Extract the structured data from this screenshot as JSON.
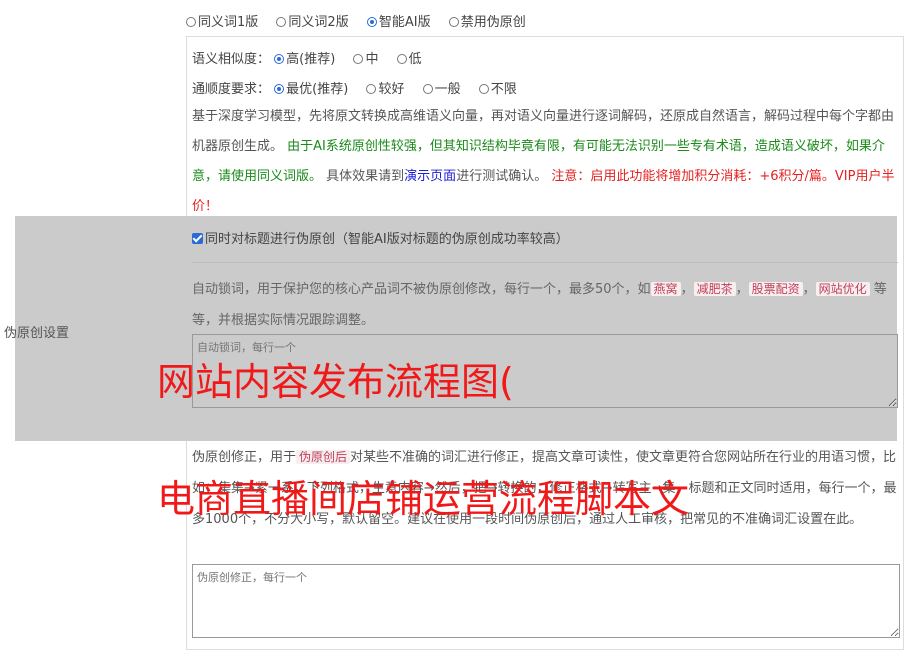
{
  "mode_options": [
    {
      "label": "同义词1版",
      "selected": false
    },
    {
      "label": "同义词2版",
      "selected": false
    },
    {
      "label": "智能AI版",
      "selected": true
    },
    {
      "label": "禁用伪原创",
      "selected": false
    }
  ],
  "similarity": {
    "label": "语义相似度：",
    "options": [
      {
        "label": "高(推荐)",
        "selected": true
      },
      {
        "label": "中",
        "selected": false
      },
      {
        "label": "低",
        "selected": false
      }
    ]
  },
  "fluency": {
    "label": "通顺度要求：",
    "options": [
      {
        "label": "最优(推荐)",
        "selected": true
      },
      {
        "label": "较好",
        "selected": false
      },
      {
        "label": "一般",
        "selected": false
      },
      {
        "label": "不限",
        "selected": false
      }
    ]
  },
  "description": {
    "part1": "基于深度学习模型，先将原文转换成高维语义向量，再对语义向量进行逐词解码，还原成自然语言，解码过程中每个字都由机器原创生成。",
    "part2": "由于AI系统原创性较强，但其知识结构毕竟有限，有可能无法识别一些专有术语，造成语义破坏，如果介意，请使用同义词版。",
    "part3": "具体效果请到",
    "link": "演示页面",
    "part4": "进行测试确认。",
    "warning": "注意：启用此功能将增加积分消耗：+6积分/篇。VIP用户半价！"
  },
  "section_label": "伪原创设置",
  "title_checkbox": {
    "label": "同时对标题进行伪原创（智能AI版对标题的伪原创成功率较高）",
    "checked": true
  },
  "lock_words": {
    "desc_before": "自动锁词，用于保护您的核心产品词不被伪原创修改，每行一个，最多50个，如",
    "examples": [
      "燕窝",
      "减肥茶",
      "股票配资",
      "网站优化"
    ],
    "desc_after": "等等，并根据实际情况跟踪调整。",
    "placeholder": "自动锁词，每行一个"
  },
  "fix_words": {
    "desc_before": "伪原创修正，用于",
    "highlight": "伪原创后",
    "desc_after": "对某些不准确的词汇进行修正，提高文章可读性，使文章更符合您网站所在行业的用语习惯，比如：集集→紧一系，下列格式，生意内容→然后，把→转换的，修正格式→转写主→集，标题和正文同时适用，每行一个，最多1000个，不分大小写，默认留空。建议在使用一段时间伪原创后，通过人工审核，把常见的不准确词汇设置在此。",
    "placeholder": "伪原创修正，每行一个"
  },
  "watermark": {
    "line1": "网站内容发布流程图(",
    "line2": "电商直播间店铺运营流程脚本文"
  }
}
